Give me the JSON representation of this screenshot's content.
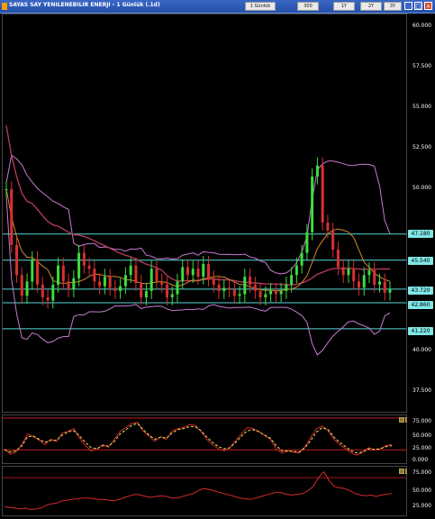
{
  "window": {
    "title": "SAYAS SAY YENILENEBILIR ENERJI - 1 Günlük (.1d)",
    "toolbar": {
      "interval": "1 Günlük",
      "btn1": "300",
      "btn2": "1Y",
      "btn3": "2Y",
      "btn4": "3Y"
    }
  },
  "price_axis": {
    "ticks": [
      "60.000",
      "57.500",
      "55.000",
      "52.500",
      "50.000",
      "40.000",
      "37.500"
    ],
    "levels": [
      "47.180",
      "45.540",
      "43.720",
      "42.860",
      "41.220"
    ]
  },
  "osc1_axis": {
    "ticks": [
      "75.000",
      "50.000",
      "25.000",
      "0.000"
    ]
  },
  "osc2_axis": {
    "ticks": [
      "75.000",
      "50.000",
      "25.000"
    ]
  },
  "chart_data": [
    {
      "type": "line",
      "title": "SAYAS SAY YENILENEBILIR ENERJI - 1 Günlük (.1d)",
      "ylim": [
        36,
        61
      ],
      "horizontal_levels": [
        47.18,
        45.54,
        43.72,
        42.86,
        41.22
      ],
      "series": [
        {
          "values": [
            50.0,
            46.5,
            44.6,
            43.3,
            44.2,
            45.6,
            44.0,
            43.2,
            43.0,
            44.0,
            45.2,
            44.2,
            43.7,
            44.4,
            46.0,
            45.2,
            45.0,
            44.2,
            43.9,
            44.5,
            43.8,
            43.6,
            43.9,
            44.6,
            45.2,
            44.1,
            43.2,
            43.6,
            45.0,
            44.2,
            44.0,
            43.2,
            43.4,
            44.2,
            45.1,
            44.6,
            45.0,
            44.5,
            45.3,
            44.4,
            44.0,
            43.6,
            43.8,
            43.7,
            43.3,
            43.4,
            44.5,
            44.0,
            43.6,
            43.2,
            43.4,
            43.6,
            43.4,
            43.6,
            44.0,
            44.6,
            45.2,
            46.0,
            47.3,
            50.8,
            51.5,
            47.9,
            47.4,
            46.2,
            45.1,
            44.6,
            45.0,
            44.2,
            43.8,
            44.6,
            44.9,
            44.0,
            44.2,
            43.5,
            43.7
          ]
        }
      ]
    },
    {
      "type": "line",
      "ylim": [
        -5,
        85
      ],
      "series": [
        {
          "values": [
            22,
            12,
            16,
            30,
            50,
            45,
            38,
            30,
            40,
            36,
            52,
            55,
            60,
            42,
            28,
            18,
            22,
            30,
            25,
            40,
            55,
            62,
            70,
            72,
            55,
            46,
            36,
            45,
            40,
            56,
            60,
            62,
            68,
            66,
            55,
            40,
            30,
            22,
            18,
            24,
            38,
            50,
            62,
            60,
            55,
            47,
            40,
            22,
            14,
            18,
            16,
            14,
            26,
            44,
            60,
            65,
            56,
            40,
            30,
            22,
            14,
            10,
            16,
            24,
            20,
            22,
            28,
            30
          ]
        },
        {
          "values": [
            20,
            16,
            18,
            28,
            45,
            46,
            40,
            34,
            38,
            38,
            48,
            54,
            56,
            46,
            34,
            24,
            22,
            28,
            27,
            36,
            50,
            58,
            66,
            70,
            58,
            48,
            40,
            44,
            42,
            52,
            58,
            60,
            64,
            64,
            56,
            44,
            34,
            26,
            22,
            24,
            34,
            46,
            56,
            58,
            54,
            48,
            42,
            28,
            18,
            18,
            17,
            16,
            24,
            38,
            54,
            62,
            58,
            44,
            34,
            26,
            18,
            14,
            16,
            22,
            21,
            22,
            26,
            28
          ]
        }
      ]
    },
    {
      "type": "line",
      "ylim": [
        18,
        85
      ],
      "series": [
        {
          "values": [
            30,
            29,
            28,
            27,
            28,
            26,
            27,
            28,
            32,
            34,
            35,
            38,
            39,
            40,
            41,
            42,
            42,
            41,
            40,
            40,
            39,
            38,
            40,
            43,
            45,
            47,
            46,
            44,
            43,
            44,
            45,
            44,
            42,
            42,
            44,
            46,
            48,
            52,
            55,
            54,
            52,
            50,
            48,
            46,
            44,
            42,
            41,
            40,
            42,
            44,
            46,
            48,
            50,
            49,
            47,
            46,
            47,
            48,
            52,
            58,
            70,
            78,
            66,
            58,
            56,
            55,
            52,
            48,
            46,
            45,
            46,
            44,
            46,
            47,
            48
          ]
        }
      ]
    }
  ]
}
